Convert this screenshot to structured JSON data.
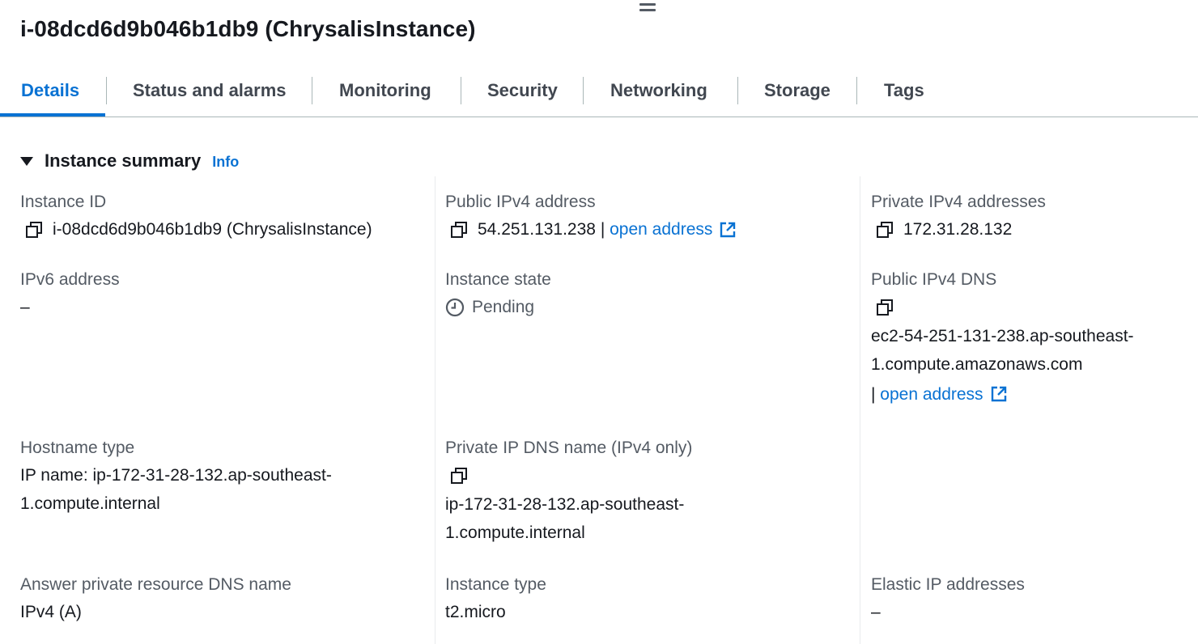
{
  "header": {
    "title": "i-08dcd6d9b046b1db9 (ChrysalisInstance)"
  },
  "tabs": [
    {
      "label": "Details",
      "active": true
    },
    {
      "label": "Status and alarms",
      "active": false
    },
    {
      "label": "Monitoring",
      "active": false
    },
    {
      "label": "Security",
      "active": false
    },
    {
      "label": "Networking",
      "active": false
    },
    {
      "label": "Storage",
      "active": false
    },
    {
      "label": "Tags",
      "active": false
    }
  ],
  "section": {
    "title": "Instance summary",
    "info_label": "Info",
    "expanded": true
  },
  "fields": {
    "instance_id": {
      "label": "Instance ID",
      "value": "i-08dcd6d9b046b1db9 (ChrysalisInstance)"
    },
    "public_ipv4": {
      "label": "Public IPv4 address",
      "value": "54.251.131.238",
      "separator": " | ",
      "link": "open address"
    },
    "private_ipv4": {
      "label": "Private IPv4 addresses",
      "value": "172.31.28.132"
    },
    "ipv6": {
      "label": "IPv6 address",
      "value": "–"
    },
    "instance_state": {
      "label": "Instance state",
      "value": "Pending"
    },
    "public_dns": {
      "label": "Public IPv4 DNS",
      "value_line1": "ec2-54-251-131-238.ap-southeast-",
      "value_line2": "1.compute.amazonaws.com",
      "separator": "| ",
      "link": "open address"
    },
    "hostname_type": {
      "label": "Hostname type",
      "value_line1": "IP name: ip-172-31-28-132.ap-southeast-",
      "value_line2": "1.compute.internal"
    },
    "private_dns": {
      "label": "Private IP DNS name (IPv4 only)",
      "value_line1": "ip-172-31-28-132.ap-southeast-",
      "value_line2": "1.compute.internal"
    },
    "answer_dns": {
      "label": "Answer private resource DNS name",
      "value": "IPv4 (A)"
    },
    "instance_type": {
      "label": "Instance type",
      "value": "t2.micro"
    },
    "elastic_ip": {
      "label": "Elastic IP addresses",
      "value": "–"
    }
  },
  "colors": {
    "link": "#0972d3",
    "text": "#16191f",
    "label": "#545b64",
    "divider": "#e9ebed"
  },
  "icons": {
    "copy": "copy-icon",
    "external": "external-link-icon",
    "state": "clock-icon",
    "caret": "caret-down-icon",
    "drag": "drag-handle-icon"
  }
}
